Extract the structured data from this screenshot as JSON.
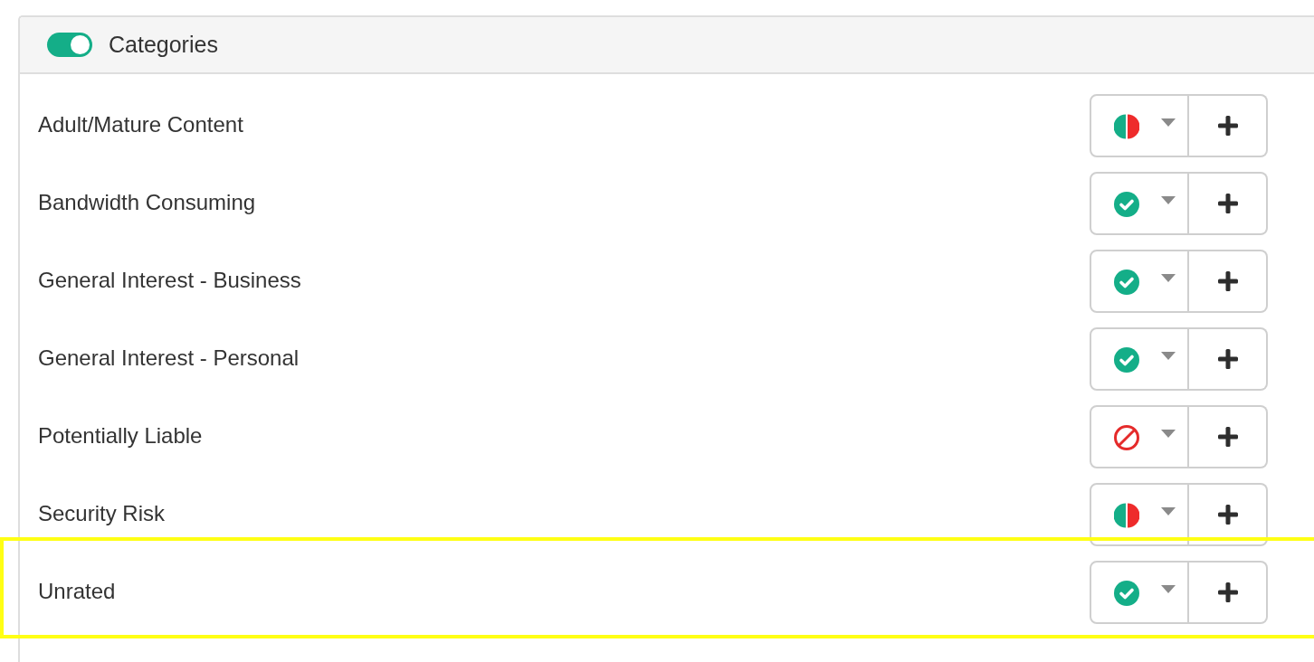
{
  "panel": {
    "title": "Categories",
    "enabled": true
  },
  "categories": [
    {
      "name": "Adult/Mature Content",
      "kind": "partial",
      "highlighted": false
    },
    {
      "name": "Bandwidth Consuming",
      "kind": "allowed",
      "highlighted": false
    },
    {
      "name": "General Interest - Business",
      "kind": "allowed",
      "highlighted": false
    },
    {
      "name": "General Interest - Personal",
      "kind": "allowed",
      "highlighted": false
    },
    {
      "name": "Potentially Liable",
      "kind": "blocked",
      "highlighted": false
    },
    {
      "name": "Security Risk",
      "kind": "partial",
      "highlighted": false
    },
    {
      "name": "Unrated",
      "kind": "allowed",
      "highlighted": true
    }
  ]
}
